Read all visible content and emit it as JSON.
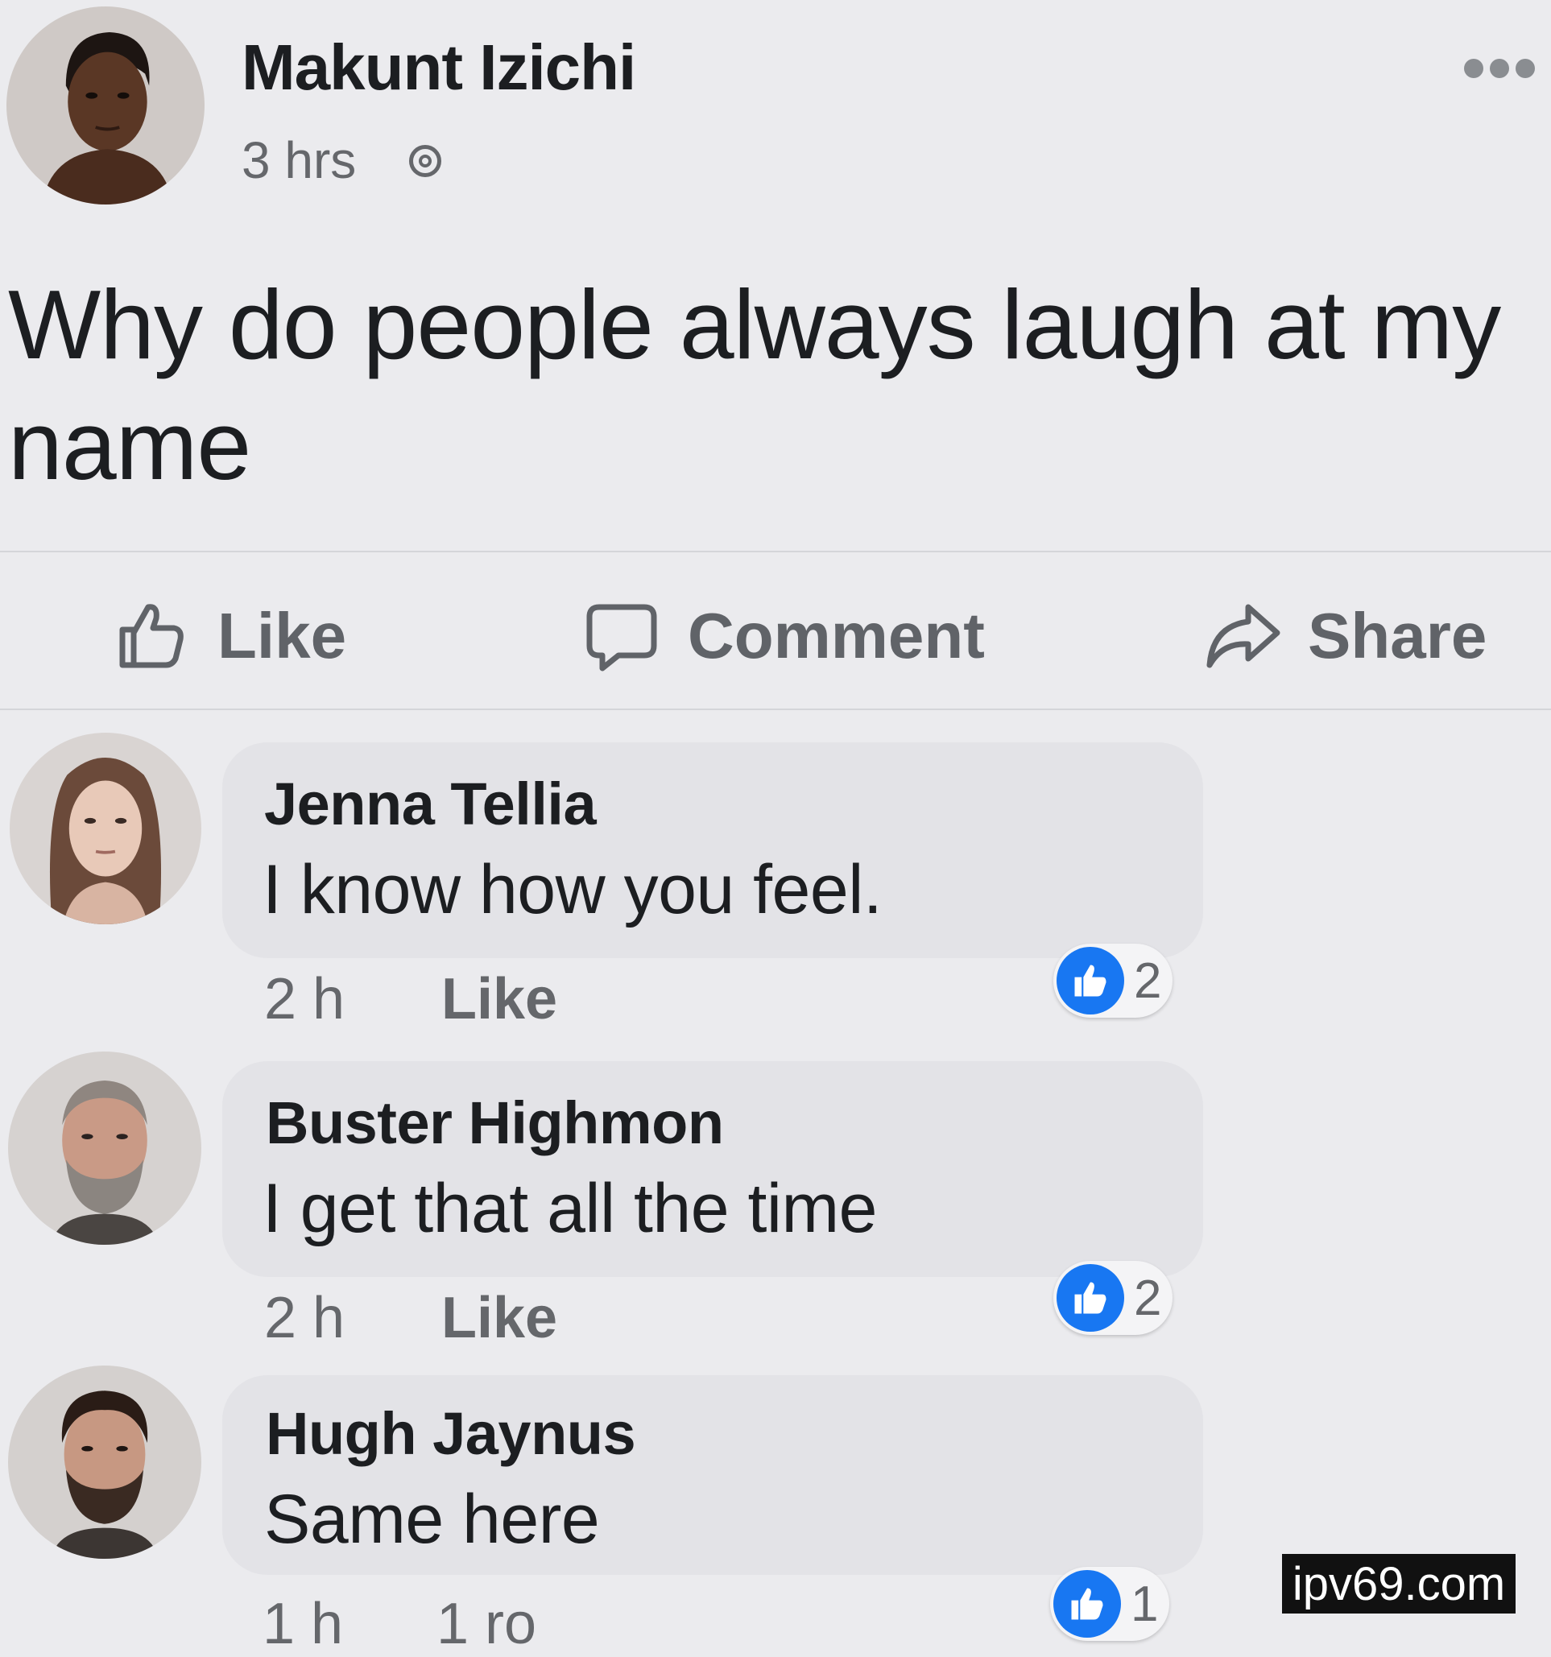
{
  "post": {
    "author": "Makunt Izichi",
    "time": "3 hrs",
    "text": "Why do people always laugh at my name"
  },
  "actions": {
    "like_label": "Like",
    "comment_label": "Comment",
    "share_label": "Share"
  },
  "comments": [
    {
      "author": "Jenna Tellia",
      "text": "I know how you feel.",
      "time": "2 h",
      "like_label": "Like",
      "reactions": "2"
    },
    {
      "author": "Buster Highmon",
      "text": "I get that all the time",
      "time": "2 h",
      "like_label": "Like",
      "reactions": "2"
    },
    {
      "author": "Hugh Jaynus",
      "text": "Same here",
      "time": "1 h",
      "like_label": "1 ro",
      "reactions": "1"
    }
  ],
  "watermark": "ipv69.com",
  "icons": {
    "post_avatar": "avatar",
    "globe": "globe-icon",
    "more": "more-options-icon",
    "like": "thumbs-up-icon",
    "comment": "speech-bubble-icon",
    "share": "share-arrow-icon",
    "reaction": "like-reaction-icon"
  },
  "colors": {
    "background": "#ebebee",
    "bubble": "#e3e3e7",
    "reaction_blue": "#1877f2",
    "secondary_text": "#65676b"
  }
}
